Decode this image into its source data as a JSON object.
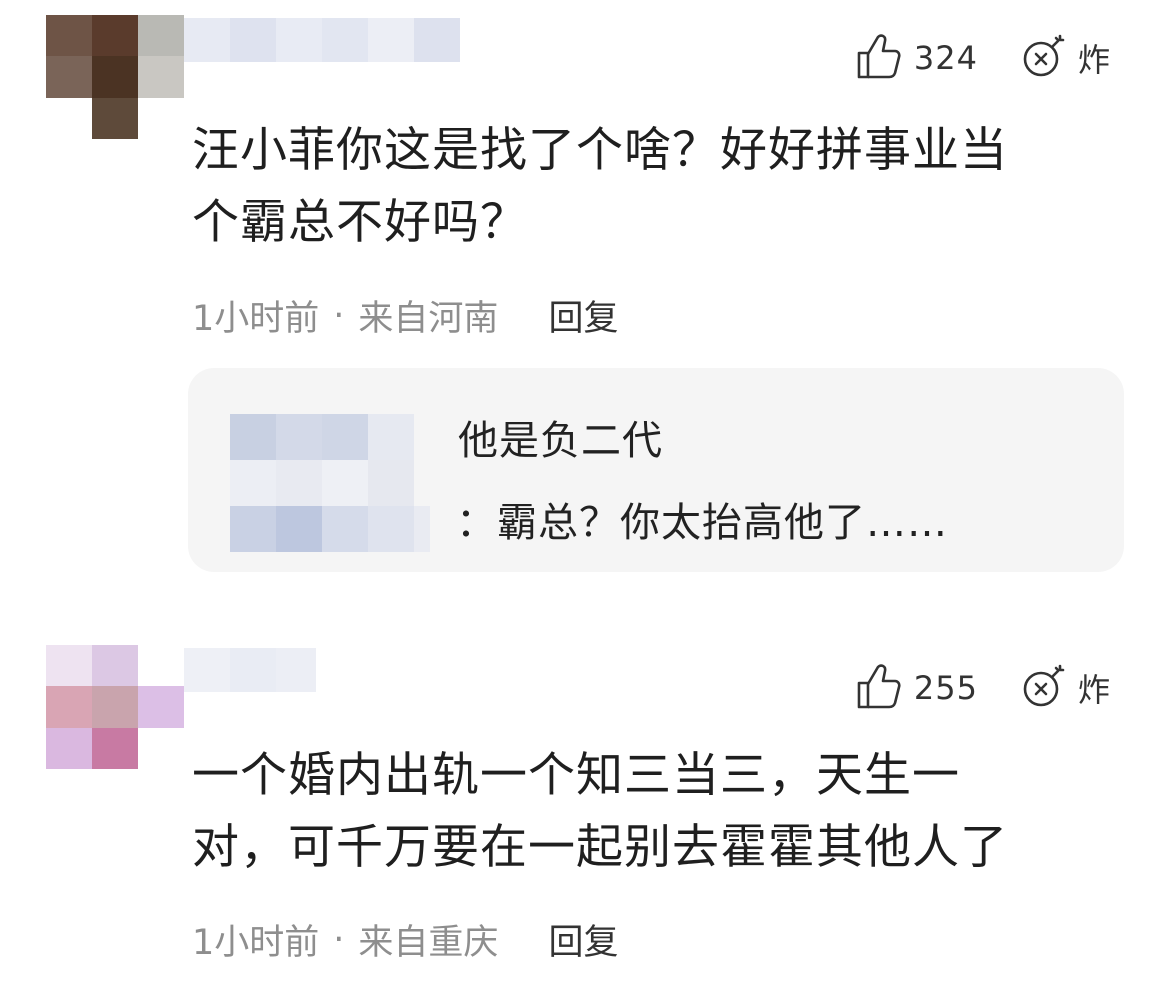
{
  "comments": [
    {
      "likes": "324",
      "bomb_label": "炸",
      "text": "汪小菲你这是找了个啥？好好拼事业当\n个霸总不好吗？",
      "time": "1小时前",
      "separator": "·",
      "location": "来自河南",
      "reply_label": "回复",
      "replies": [
        {
          "text": "他是负二代"
        },
        {
          "text": "：霸总？你太抬高他了……"
        }
      ]
    },
    {
      "likes": "255",
      "bomb_label": "炸",
      "text": "一个婚内出轨一个知三当三，天生一\n对，可千万要在一起别去霍霍其他人了",
      "time": "1小时前",
      "separator": "·",
      "location": "来自重庆",
      "reply_label": "回复"
    }
  ],
  "icons": {
    "like": "thumbs-up-icon",
    "bomb": "bomb-icon"
  },
  "colors": {
    "text": "#1f1f1f",
    "meta": "#8e8e8e",
    "reply_bg": "#f5f5f5"
  }
}
